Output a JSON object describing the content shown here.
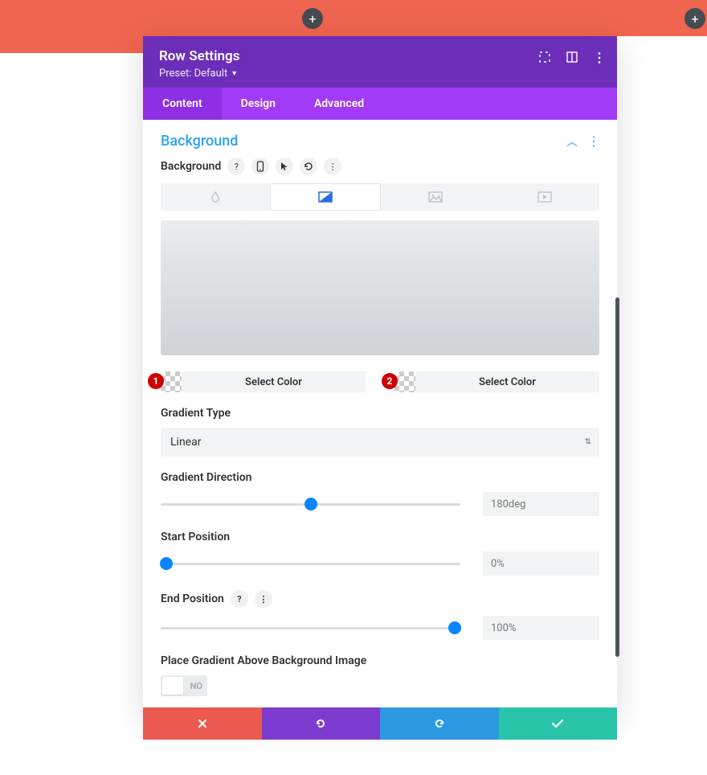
{
  "header": {
    "title": "Row Settings",
    "preset_label": "Preset: Default"
  },
  "tabs": {
    "content": "Content",
    "design": "Design",
    "advanced": "Advanced",
    "active": "Content"
  },
  "section": {
    "title": "Background",
    "field_label": "Background"
  },
  "color1": {
    "label": "Select Color",
    "badge": "1"
  },
  "color2": {
    "label": "Select Color",
    "badge": "2"
  },
  "gradient_type": {
    "label": "Gradient Type",
    "value": "Linear"
  },
  "gradient_direction": {
    "label": "Gradient Direction",
    "value": "180deg",
    "percent": 50
  },
  "start_position": {
    "label": "Start Position",
    "value": "0%",
    "percent": 0
  },
  "end_position": {
    "label": "End Position",
    "value": "100%",
    "percent": 100
  },
  "place_above": {
    "label": "Place Gradient Above Background Image",
    "state_label": "NO"
  },
  "colors": {
    "accent": "#2ea3f2",
    "header_bg": "#6c2eb9",
    "tabs_bg": "#a13bf6"
  },
  "icons": {
    "expand": "expand-icon",
    "snap": "snap-icon",
    "more": "more-icon",
    "help": "help-icon",
    "phone": "phone-icon",
    "cursor": "cursor-icon",
    "reset": "reset-icon",
    "color_tab": "color-drop-icon",
    "gradient_tab": "gradient-icon",
    "image_tab": "image-icon",
    "video_tab": "video-icon"
  }
}
